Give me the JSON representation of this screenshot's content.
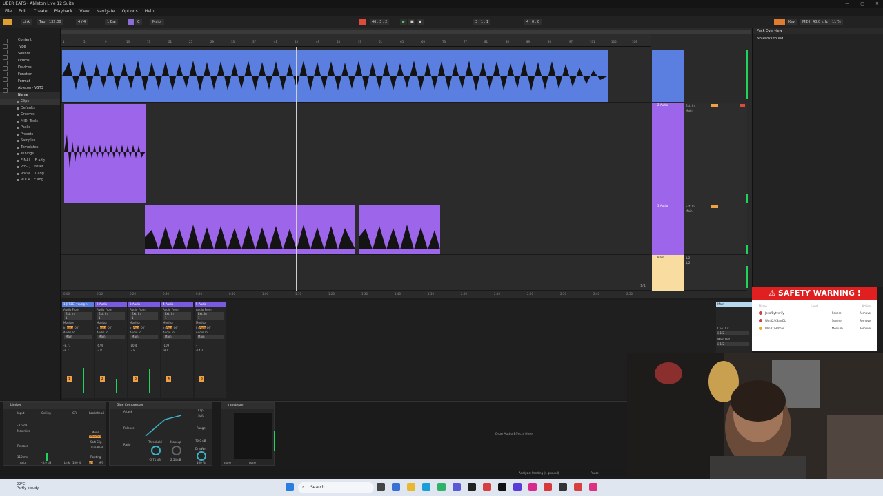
{
  "window": {
    "title": "UBER EATS - Ableton Live 12 Suite",
    "controls": [
      "—",
      "▢",
      "✕"
    ]
  },
  "menu": [
    "File",
    "Edit",
    "Create",
    "Playback",
    "View",
    "Navigate",
    "Options",
    "Help"
  ],
  "control_bar": {
    "link": "Link",
    "tap": "Tap",
    "tempo": "132.00",
    "time_sig": "4 / 4",
    "quantize": "1 Bar",
    "key": "C",
    "scale": "Major",
    "position": "46 . 3 . 2",
    "loop_start": "3 . 1 . 1",
    "loop_length": "4 . 0 . 0",
    "key_label": "Key",
    "midi_label": "MIDI",
    "sample_rate": "48.0 kHz",
    "cpu": "11 %"
  },
  "browser": {
    "categories": [
      "Content",
      "Type",
      "Sounds",
      "Drums",
      "Devices",
      "Function",
      "Format",
      "Ableton · VST3"
    ],
    "section": "Name",
    "items": [
      "Clips",
      "Defaults",
      "Grooves",
      "MIDI Tools",
      "Packs",
      "Presets",
      "Samples",
      "Templates",
      "Tunings",
      "FINAL ...E.adg",
      "Pro-Q ...reset",
      "Vocal ...1.adg",
      "VOCA...E.adg"
    ],
    "selected_index": 0
  },
  "ruler": {
    "bars": [
      "1",
      "5",
      "9",
      "13",
      "17",
      "21",
      "25",
      "29",
      "33",
      "37",
      "41",
      "45",
      "49",
      "53",
      "57",
      "61",
      "65",
      "69",
      "73",
      "77",
      "81",
      "85",
      "89",
      "93",
      "97",
      "101",
      "105",
      "109"
    ],
    "times": [
      "0:00",
      "0:10",
      "0:20",
      "0:30",
      "0:40",
      "0:50",
      "1:00",
      "1:10",
      "1:20",
      "1:30",
      "1:40",
      "1:50",
      "2:00",
      "2:10",
      "2:20",
      "2:30",
      "2:40",
      "2:50"
    ],
    "page": "1/1"
  },
  "tracks": [
    {
      "name": "1 [FREE] young n",
      "color": "#5b7fe0",
      "input": "Ext. In",
      "route": "Main"
    },
    {
      "name": "2 Audio",
      "color": "#9d66ea",
      "input": "Ext. In",
      "route": "Main"
    },
    {
      "name": "3 Audio",
      "color": "#9d66ea",
      "input": "Ext. In",
      "route": "Main"
    }
  ],
  "main_track": {
    "name": "Main",
    "input_a": "1/2",
    "input_b": "1/2",
    "color": "#f8dca0"
  },
  "pack_overview": {
    "title": "Pack Overview",
    "message": "No Packs found."
  },
  "safety_warning": {
    "title": "SAFETY WARNING !",
    "columns": [
      "Name",
      "Level",
      "Action"
    ],
    "threats": [
      {
        "name": "Java/Bytverify",
        "level": "Severe",
        "action": "Remove"
      },
      {
        "name": "Win32/KBav.DL",
        "level": "Severe",
        "action": "Remove"
      },
      {
        "name": "Win32/Hotbar",
        "level": "Medium",
        "action": "Remove"
      }
    ]
  },
  "mixer": {
    "strips": [
      {
        "title": "1 [FREE] young n",
        "audio_from": "Audio From",
        "input": "Ext. In",
        "channel": "1",
        "monitor": "Monitor",
        "monitor_opts": [
          "In",
          "Auto",
          "Off"
        ],
        "audio_to": "Audio To",
        "route": "Main",
        "vol": "-8.77",
        "peak": "-8.7",
        "number": "1"
      },
      {
        "title": "2 Audio",
        "audio_from": "Audio From",
        "input": "Ext. In",
        "channel": "1",
        "monitor": "Monitor",
        "monitor_opts": [
          "In",
          "Auto",
          "Off"
        ],
        "audio_to": "Audio To",
        "route": "Main",
        "vol": "-6.90",
        "peak": "-7.8",
        "number": "2"
      },
      {
        "title": "3 Audio",
        "audio_from": "Audio From",
        "input": "Ext. In",
        "channel": "1",
        "monitor": "Monitor",
        "monitor_opts": [
          "In",
          "Auto",
          "Off"
        ],
        "audio_to": "Audio To",
        "route": "Main",
        "vol": "-10.4",
        "peak": "-7.8",
        "number": "3"
      },
      {
        "title": "4 Audio",
        "audio_from": "Audio From",
        "input": "Ext. In",
        "channel": "1",
        "monitor": "Monitor",
        "monitor_opts": [
          "In",
          "Auto",
          "Off"
        ],
        "audio_to": "Audio To",
        "route": "Main",
        "vol": "-109",
        "peak": "-9.1",
        "number": "4"
      },
      {
        "title": "5 Audio",
        "audio_from": "Audio From",
        "input": "Ext. In",
        "channel": "1",
        "monitor": "Monitor",
        "monitor_opts": [
          "In",
          "Auto",
          "Off"
        ],
        "audio_to": "Audio To",
        "route": "Main",
        "vol": "-",
        "peak": "-14.2",
        "number": "5"
      }
    ],
    "main": {
      "title": "Main",
      "cue_out": "Cue Out",
      "cue_val": "ii 1/2",
      "main_out": "Main Out",
      "main_val": "ii 1/2"
    }
  },
  "devices": {
    "limiter": {
      "title": "Limiter",
      "input": "Input",
      "ceiling": "Ceiling",
      "gr": "GR",
      "release": "Release",
      "release_val": "110 ms",
      "auto": "Auto",
      "lookahead": "Lookahead",
      "mode": "Mode",
      "mode_val": "Standard",
      "soft_clip": "Soft Clip",
      "true_peak": "True Peak",
      "routing": "Routing",
      "routing_val": "L/R",
      "ms": "M/S",
      "link": "Link",
      "link_val": "100 %",
      "input_val": "-3.5 dB",
      "maximize": "Maximize",
      "gain_val": "-3.9 dB"
    },
    "glue": {
      "title": "Glue Compressor",
      "attack": "Attack",
      "release": "Release",
      "ratio": "Ratio",
      "threshold": "Threshold",
      "threshold_val": "-5.71 dB",
      "makeup": "Makeup",
      "makeup_val": "2.54 dB",
      "range": "Range",
      "range_val": "70.0 dB",
      "dry_wet": "Dry/Wet",
      "dry_wet_val": "100 %",
      "clip": "Clip",
      "soft": "Soft"
    },
    "rax": {
      "title": "raxstream",
      "none_a": "none",
      "none_b": "none"
    },
    "drop_text": "Drop Audio Effects Here"
  },
  "status": {
    "analysis": "Analysis: Pending (4 queued)",
    "pause": "Pause"
  },
  "taskbar": {
    "temp": "22°C",
    "weather": "Partly cloudy",
    "search": "Search"
  },
  "colors": {
    "accent_orange": "#e07b2f",
    "track_blue": "#5b7fe0",
    "track_purple": "#9d66ea",
    "meter_green": "#1fd35b",
    "warning_red": "#e02020"
  }
}
